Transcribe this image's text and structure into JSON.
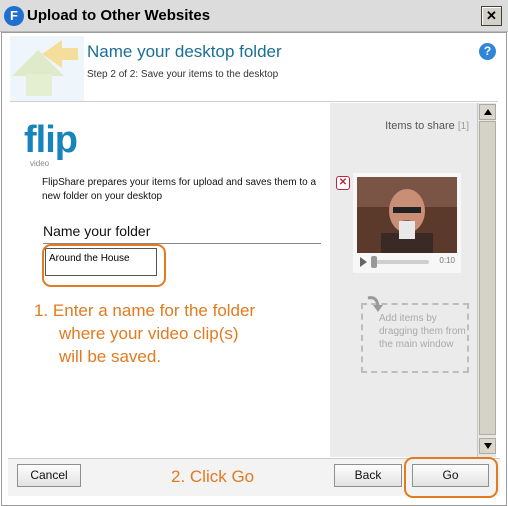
{
  "window": {
    "title": "Upload to Other Websites",
    "app_icon": "F",
    "close_label": "✕"
  },
  "header": {
    "title": "Name your desktop folder",
    "subtitle": "Step 2 of 2: Save your items to the desktop",
    "help_label": "?"
  },
  "logo": {
    "text": "flip",
    "subtext": "video"
  },
  "main": {
    "description": "FlipShare prepares your items for upload and saves them to a new folder on your desktop",
    "folder_label": "Name your folder",
    "folder_value": "Around the House"
  },
  "annotations": {
    "step1_line1": "1. Enter a name for the folder",
    "step1_line2": "where your video clip(s)",
    "step1_line3": "will be saved.",
    "step2": "2. Click Go",
    "color": "#e27a1f"
  },
  "side": {
    "share_label": "Items to share",
    "share_count": "[1]",
    "remove_label": "✕",
    "player_time": "0:10",
    "drop_text": "Add items by dragging them from the main window"
  },
  "footer": {
    "cancel_label": "Cancel",
    "back_label": "Back",
    "go_label": "Go"
  },
  "colors": {
    "accent_blue": "#1b6e97",
    "logo_blue": "#1784bc",
    "highlight": "#e27a1f"
  }
}
